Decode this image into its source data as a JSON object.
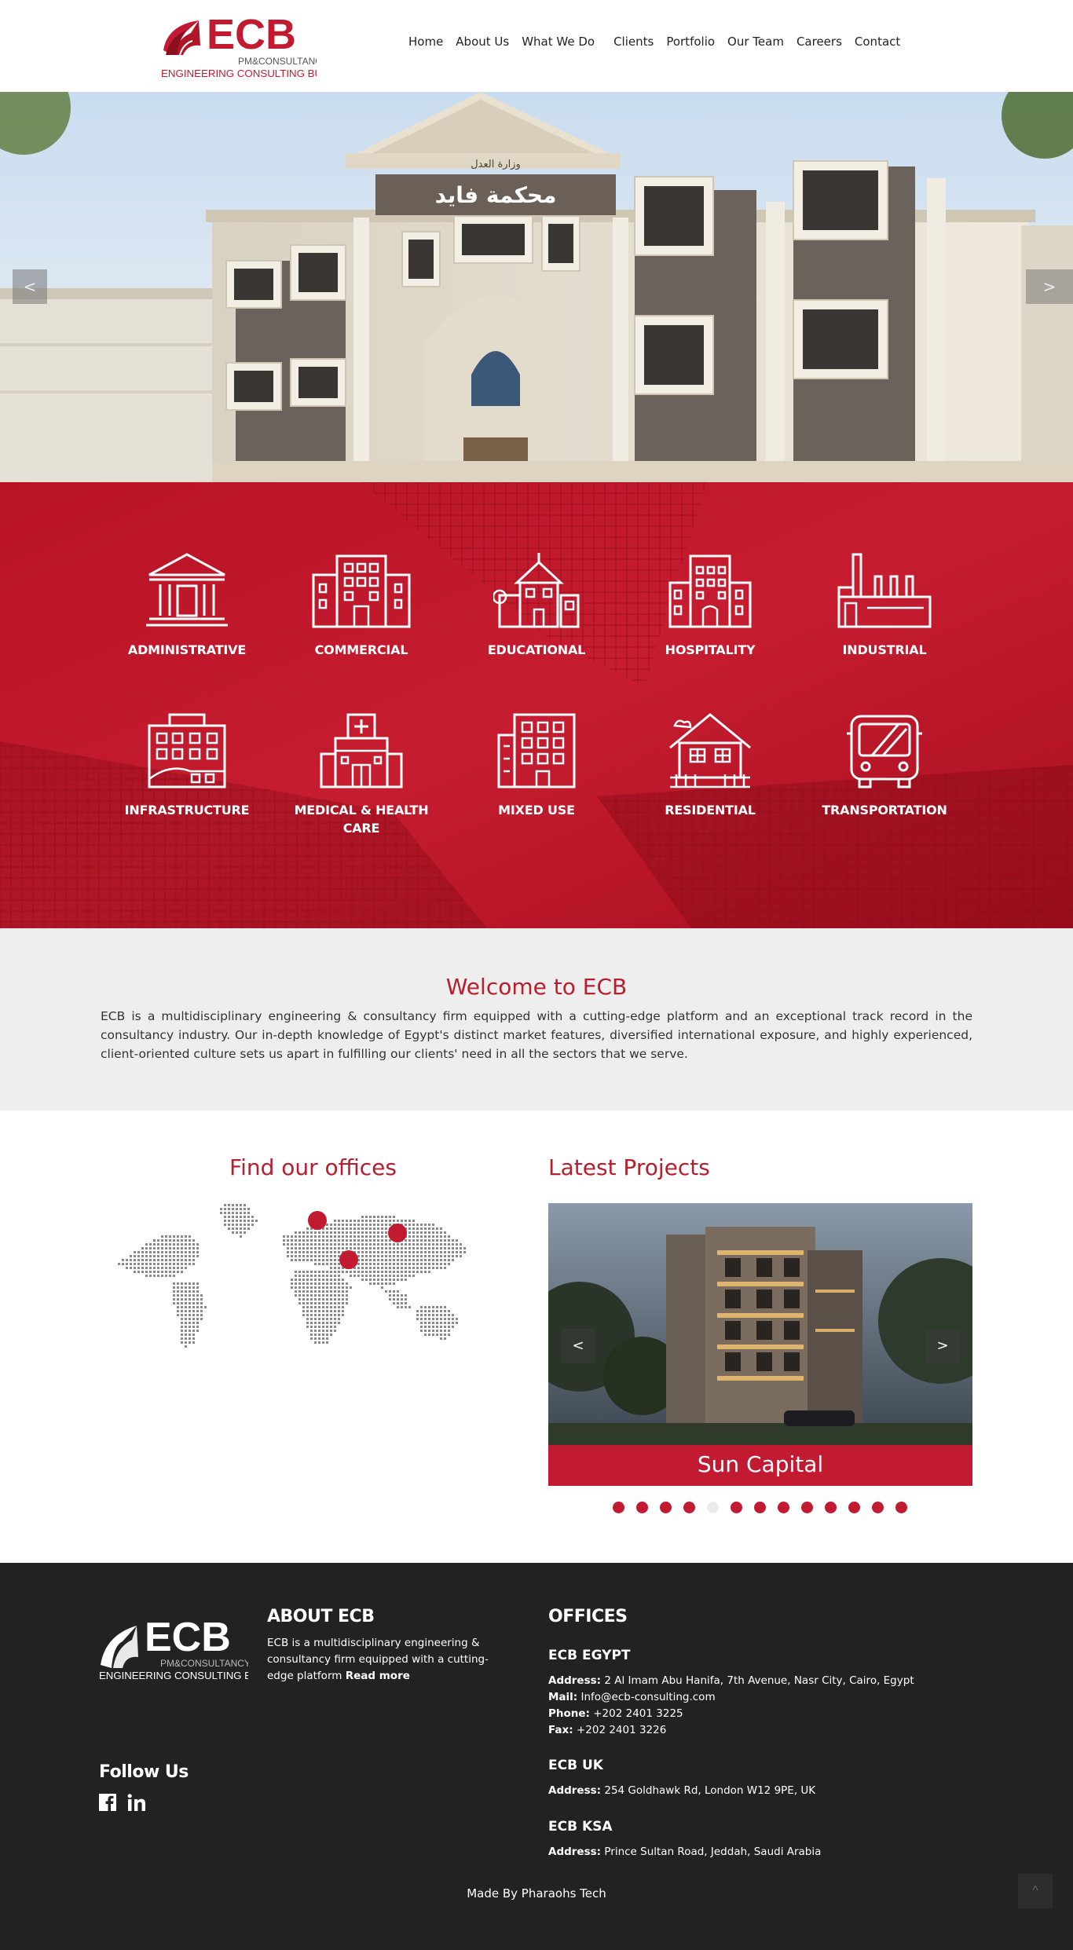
{
  "header": {
    "logo_text": "ECB",
    "logo_sub1": "PM&CONSULTANCY",
    "logo_sub2": "ENGINEERING CONSULTING BUREAU",
    "nav": [
      "Home",
      "About Us",
      "What We Do",
      "Clients",
      "Portfolio",
      "Our Team",
      "Careers",
      "Contact"
    ]
  },
  "hero": {
    "sign_text": "محكمة فايد",
    "sign_small": "وزارة العدل",
    "prev": "<",
    "next": ">"
  },
  "sectors": [
    {
      "label": "ADMINISTRATIVE",
      "icon": "courthouse-icon"
    },
    {
      "label": "COMMERCIAL",
      "icon": "commercial-building-icon"
    },
    {
      "label": "EDUCATIONAL",
      "icon": "school-icon"
    },
    {
      "label": "HOSPITALITY",
      "icon": "hotel-icon"
    },
    {
      "label": "INDUSTRIAL",
      "icon": "factory-icon"
    },
    {
      "label": "INFRASTRUCTURE",
      "icon": "infrastructure-icon"
    },
    {
      "label": "MEDICAL & HEALTH CARE",
      "icon": "hospital-icon"
    },
    {
      "label": "MIXED USE",
      "icon": "mixed-use-icon"
    },
    {
      "label": "RESIDENTIAL",
      "icon": "house-icon"
    },
    {
      "label": "TRANSPORTATION",
      "icon": "bus-icon"
    }
  ],
  "welcome": {
    "title": "Welcome to ECB",
    "body": "ECB is a multidisciplinary engineering & consultancy firm equipped with a cutting-edge platform and an exceptional track record in the consultancy industry. Our in-depth knowledge of Egypt's distinct market features, diversified international exposure, and highly experienced, client-oriented culture sets us apart in fulfilling our clients' need in all the sectors that we serve."
  },
  "offices_section": {
    "title": "Find our offices"
  },
  "projects": {
    "title": "Latest Projects",
    "current": "Sun Capital",
    "prev": "<",
    "next": ">",
    "dot_count": 13,
    "active_dot": 5
  },
  "footer": {
    "logo_text": "ECB",
    "logo_sub1": "PM&CONSULTANCY",
    "logo_sub2": "ENGINEERING CONSULTING BUREAU",
    "about_title": "ABOUT ECB",
    "about_text": "ECB is a multidisciplinary engineering & consultancy firm equipped with a cutting-edge platform",
    "read_more": "Read more",
    "follow_title": "Follow Us",
    "offices_title": "OFFICES",
    "offices": [
      {
        "name": "ECB EGYPT",
        "address_label": "Address:",
        "address": "2 Al Imam Abu Hanifa, 7th Avenue, Nasr City, Cairo, Egypt",
        "mail_label": "Mail:",
        "mail": "Info@ecb-consulting.com",
        "phone_label": "Phone:",
        "phone": "+202 2401 3225",
        "fax_label": "Fax:",
        "fax": "+202 2401 3226"
      },
      {
        "name": "ECB UK",
        "address_label": "Address:",
        "address": "254 Goldhawk Rd, London W12 9PE, UK"
      },
      {
        "name": "ECB KSA",
        "address_label": "Address:",
        "address": "Prince Sultan Road, Jeddah, Saudi Arabia"
      }
    ],
    "made_by": "Made By Pharaohs Tech",
    "to_top": "^"
  }
}
